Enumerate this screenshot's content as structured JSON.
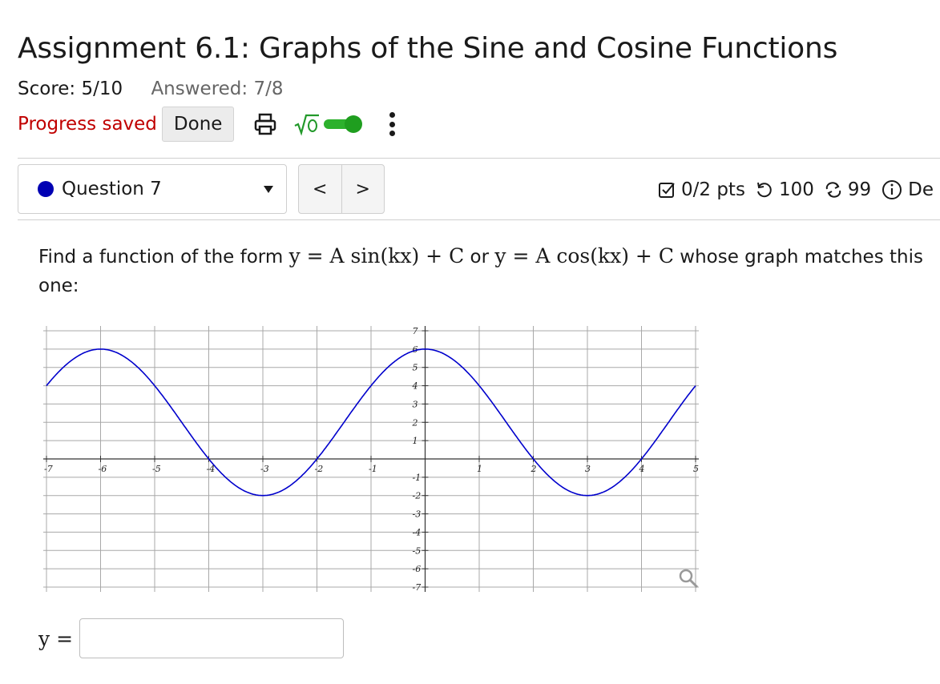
{
  "assignment": {
    "title": "Assignment 6.1: Graphs of the Sine and Cosine Functions",
    "score": "Score: 5/10",
    "answered": "Answered: 7/8"
  },
  "toolbar": {
    "progress": "Progress saved",
    "done_label": "Done",
    "icons": [
      "printer-icon",
      "sqrt-icon",
      "toggle-switch",
      "kebab-menu-icon"
    ]
  },
  "question": {
    "label": "Question 7",
    "prev": "<",
    "next": ">",
    "points": "0/2 pts",
    "attempts": "100",
    "versions": "99",
    "details": "De"
  },
  "problem": {
    "text_before": "Find a function of the form",
    "form_sin": "y = A sin(kx) + C",
    "connector": "or",
    "form_cos": "y = A cos(kx) + C",
    "text_after": "whose graph matches this one:"
  },
  "chart_data": {
    "type": "line",
    "xlim": [
      -7,
      5
    ],
    "ylim": [
      -7,
      7
    ],
    "x_ticks": [
      -7,
      -6,
      -5,
      -4,
      -3,
      -2,
      -1,
      1,
      2,
      3,
      4,
      5
    ],
    "y_ticks": [
      -7,
      -6,
      -5,
      -4,
      -3,
      -2,
      -1,
      1,
      2,
      3,
      4,
      5,
      6,
      7
    ],
    "grid": true,
    "curve_color": "#0000cc",
    "series": [
      {
        "function": "4*cos((pi/3)*x) + 2",
        "x": [
          -7,
          -6,
          -4.5,
          -4,
          -3,
          -2,
          -0.5,
          0,
          1.5,
          2,
          3,
          4,
          5
        ],
        "y": [
          4,
          6,
          2,
          0,
          -2,
          0,
          5.46,
          6,
          2,
          0,
          -2,
          0,
          4
        ]
      }
    ]
  },
  "answer": {
    "label": "y =",
    "value": ""
  },
  "colors": {
    "progress_text": "#c00000",
    "toggle_green": "#1f9e1f",
    "question_dot": "#0000b3"
  }
}
